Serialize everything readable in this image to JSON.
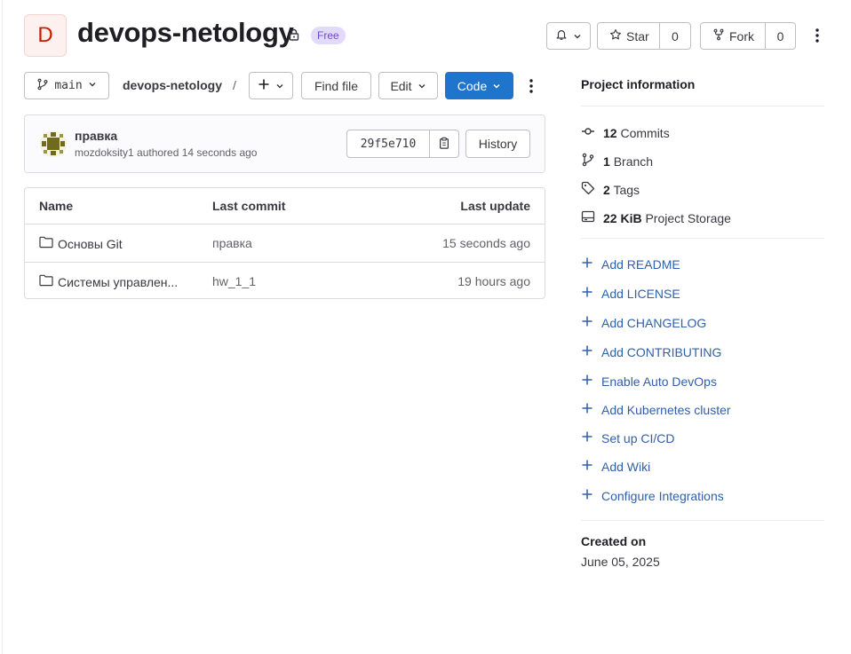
{
  "project": {
    "avatar_letter": "D",
    "title": "devops-netology",
    "badge": "Free"
  },
  "header_actions": {
    "star_label": "Star",
    "star_count": "0",
    "fork_label": "Fork",
    "fork_count": "0"
  },
  "toolbar": {
    "branch": "main",
    "breadcrumb": "devops-netology",
    "breadcrumb_sep": "/",
    "plus": "+",
    "find_file": "Find file",
    "edit": "Edit",
    "code": "Code"
  },
  "commit": {
    "title": "правка",
    "meta": "mozdoksity1 authored 14 seconds ago",
    "sha": "29f5e710",
    "history": "History"
  },
  "table": {
    "headers": {
      "name": "Name",
      "last_commit": "Last commit",
      "last_update": "Last update"
    },
    "rows": [
      {
        "name": "Основы Git",
        "commit": "правка",
        "update": "15 seconds ago"
      },
      {
        "name": "Системы управлен...",
        "commit": "hw_1_1",
        "update": "19 hours ago"
      }
    ]
  },
  "sidebar": {
    "title": "Project information",
    "stats": [
      {
        "value": "12",
        "label": "Commits",
        "icon": "commit-icon"
      },
      {
        "value": "1",
        "label": "Branch",
        "icon": "branch-icon"
      },
      {
        "value": "2",
        "label": "Tags",
        "icon": "tag-icon"
      },
      {
        "value": "22 KiB",
        "label": "Project Storage",
        "icon": "storage-icon"
      }
    ],
    "actions": [
      "Add README",
      "Add LICENSE",
      "Add CHANGELOG",
      "Add CONTRIBUTING",
      "Enable Auto DevOps",
      "Add Kubernetes cluster",
      "Set up CI/CD",
      "Add Wiki",
      "Configure Integrations"
    ],
    "created_label": "Created on",
    "created_date": "June 05, 2025"
  },
  "colors": {
    "primary_button": "#1f75cb",
    "link": "#2f5fad",
    "badge_bg": "#e1dafb",
    "badge_text": "#6e49cb",
    "avatar_text": "#c91c00"
  }
}
